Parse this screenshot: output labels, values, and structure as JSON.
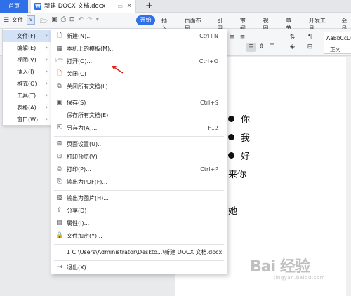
{
  "titlebar": {
    "home_tab": "首页",
    "doc_tab": "新建 DOCX 文档.docx",
    "doc_tab_icon": "W",
    "new_tab": "+"
  },
  "menubar": {
    "file_label": "文件",
    "start_tab": "开始",
    "tabs": [
      "插入",
      "页面布局",
      "引用",
      "审阅",
      "视图",
      "章节",
      "开发工具",
      "会员"
    ]
  },
  "toolbar": {
    "style_sample": "AaBbCcDd",
    "style_name": "正文"
  },
  "left_menu": {
    "items": [
      {
        "label": "文件(F)"
      },
      {
        "label": "编辑(E)"
      },
      {
        "label": "视图(V)"
      },
      {
        "label": "插入(I)"
      },
      {
        "label": "格式(O)"
      },
      {
        "label": "工具(T)"
      },
      {
        "label": "表格(A)"
      },
      {
        "label": "窗口(W)"
      }
    ]
  },
  "file_menu": {
    "items": [
      {
        "label": "新建(N)...",
        "shortcut": "Ctrl+N"
      },
      {
        "label": "本机上的模板(M)...",
        "shortcut": ""
      },
      {
        "label": "打开(O)...",
        "shortcut": "Ctrl+O"
      },
      {
        "label": "关闭(C)",
        "shortcut": ""
      },
      {
        "label": "关闭所有文档(L)",
        "shortcut": ""
      },
      {
        "label": "保存(S)",
        "shortcut": "Ctrl+S"
      },
      {
        "label": "保存所有文档(E)",
        "shortcut": ""
      },
      {
        "label": "另存为(A)...",
        "shortcut": "F12"
      },
      {
        "label": "页面设置(U)...",
        "shortcut": ""
      },
      {
        "label": "打印预览(V)",
        "shortcut": ""
      },
      {
        "label": "打印(P)...",
        "shortcut": "Ctrl+P"
      },
      {
        "label": "输出为PDF(F)...",
        "shortcut": ""
      },
      {
        "label": "输出为图片(H)...",
        "shortcut": ""
      },
      {
        "label": "分享(D)",
        "shortcut": ""
      },
      {
        "label": "属性(I)...",
        "shortcut": ""
      },
      {
        "label": "文件加密(Y)...",
        "shortcut": ""
      },
      {
        "label": "1 C:\\Users\\Administrator\\Deskto...\\新建 DOCX 文档.docx",
        "shortcut": ""
      },
      {
        "label": "退出(X)",
        "shortcut": ""
      }
    ]
  },
  "document": {
    "lines": [
      "你",
      "我",
      "好",
      "来你",
      "她"
    ]
  },
  "watermark": {
    "main": "Bai 经验",
    "sub": "jingyan.baidu.com"
  }
}
